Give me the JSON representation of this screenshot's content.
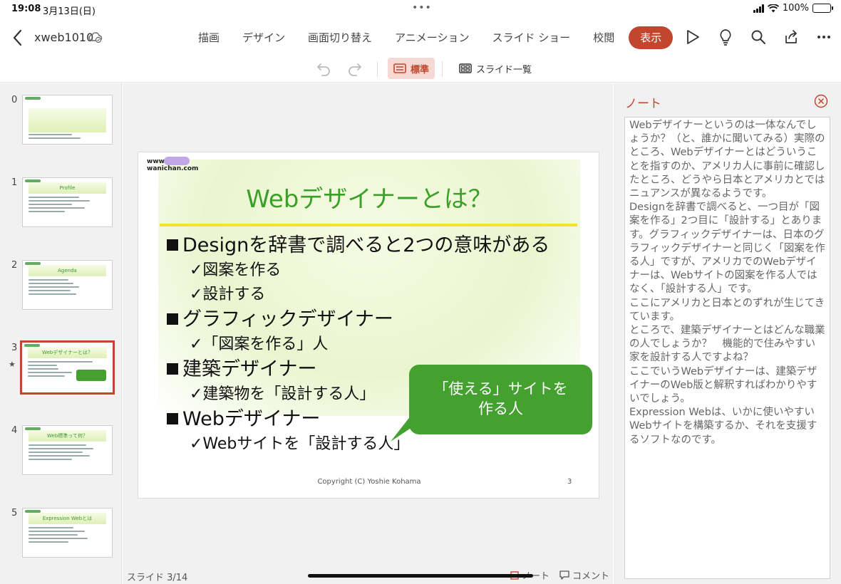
{
  "status_bar": {
    "time": "19:08",
    "date": "3月13日(日)",
    "battery": "100%"
  },
  "header": {
    "doc_title": "xweb1010",
    "tabs": [
      {
        "label": "描画"
      },
      {
        "label": "デザイン"
      },
      {
        "label": "画面切り替え"
      },
      {
        "label": "アニメーション"
      },
      {
        "label": "スライド ショー"
      },
      {
        "label": "校閲"
      },
      {
        "label": "表示"
      }
    ],
    "active_tab": "表示"
  },
  "toolbar": {
    "normal_label": "標準",
    "sorter_label": "スライド一覧"
  },
  "thumbnails": [
    {
      "num": "0",
      "title": ""
    },
    {
      "num": "1",
      "title": "Profile"
    },
    {
      "num": "2",
      "title": "Agenda"
    },
    {
      "num": "3",
      "title": "Webデザイナーとは？",
      "star": "★"
    },
    {
      "num": "4",
      "title": "Web標準って何？"
    },
    {
      "num": "5",
      "title": "Expression Webとは"
    }
  ],
  "slide": {
    "logo_line1": "www.",
    "logo_line2": "wanichan.com",
    "title": "Webデザイナーとは？",
    "b1": "Designを辞書で調べると2つの意味がある",
    "b1_1": "✓図案を作る",
    "b1_2": "✓設計する",
    "b2": "グラフィックデザイナー",
    "b2_1": "✓「図案を作る」人",
    "b3": "建築デザイナー",
    "b3_1": "✓建築物を「設計する人」",
    "b4": "Webデザイナー",
    "b4_1": "✓Webサイトを「設計する人」",
    "callout_line1": "「使える」サイトを",
    "callout_line2": "作る人",
    "footer": "Copyright (C) Yoshie Kohama",
    "page_number": "3"
  },
  "footer": {
    "slide_counter": "スライド 3/14",
    "notes_label": "ノート",
    "comment_label": "コメント"
  },
  "notes": {
    "title": "ノート",
    "paragraphs": [
      "Webデザイナーというのは一体なんでしょうか？（と、誰かに聞いてみる）実際のところ、Webデザイナーとはどういうことを指すのか、アメリカ人に事前に確認したところ、どうやら日本とアメリカとではニュアンスが異なるようです。",
      "Designを辞書で調べると、一つ目が「図案を作る」2つ目に「設計する」とあります。グラフィックデザイナーは、日本のグラフィックデザイナーと同じく「図案を作る人」ですが、アメリカでのWebデザイナーは、Webサイトの図案を作る人ではなく、「設計する人」です。",
      "ここにアメリカと日本とのずれが生じてきています。",
      "ところで、建築デザイナーとはどんな職業の人でしょうか？　機能的で住みやすい家を設計する人ですよね？",
      "ここでいうWebデザイナーは、建築デザイナーのWeb版と解釈すればわかりやすいでしょう。",
      "Expression Webは、いかに使いやすいWebサイトを構築するか、それを支援するソフトなのです。"
    ]
  },
  "colors": {
    "accent": "#c2452d",
    "slide_title": "#3aa028",
    "callout": "#44a02f",
    "title_rule": "#f0e52b"
  }
}
